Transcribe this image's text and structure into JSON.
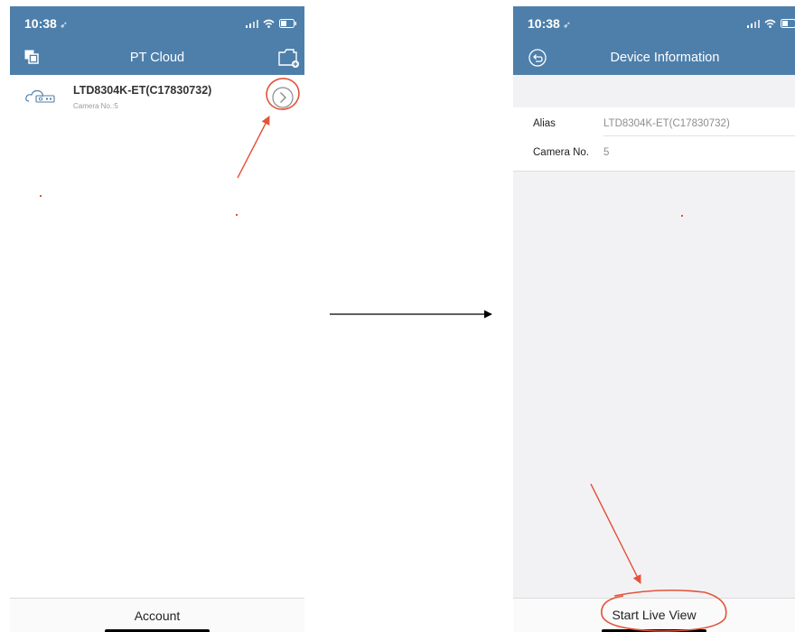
{
  "colors": {
    "header_blue": "#4d7faa",
    "annotation_red": "#e3533a",
    "text_dark": "#222222",
    "text_gray": "#8e8e8e"
  },
  "left_screen": {
    "status": {
      "time": "10:38",
      "location_icon": "location-arrow-icon"
    },
    "header": {
      "title": "PT Cloud",
      "left_icon": "multi-screen-icon",
      "right_icon": "add-device-icon"
    },
    "devices": [
      {
        "name": "LTD8304K-ET(C17830732)",
        "subtitle": "Camera No.:5",
        "icon": "cloud-device-icon",
        "detail_icon": "chevron-circle-icon"
      }
    ],
    "tabbar": {
      "label": "Account"
    }
  },
  "right_screen": {
    "status": {
      "time": "10:38"
    },
    "header": {
      "title": "Device Information",
      "back_icon": "back-icon"
    },
    "fields": [
      {
        "label": "Alias",
        "value": "LTD8304K-ET(C17830732)"
      },
      {
        "label": "Camera No.",
        "value": "5"
      }
    ],
    "action": {
      "label": "Start Live View"
    }
  },
  "transition_arrow": {
    "icon": "arrow-right-icon"
  }
}
